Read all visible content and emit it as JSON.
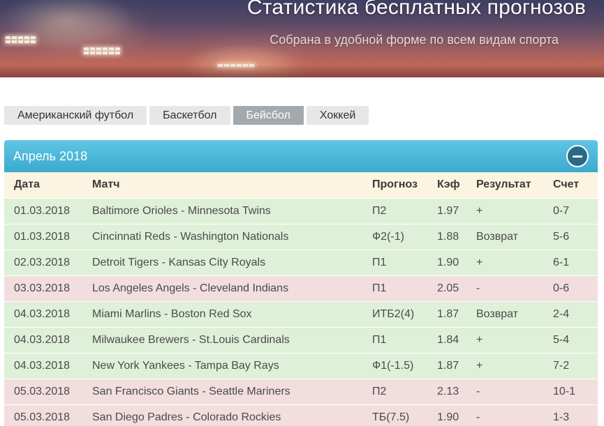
{
  "hero": {
    "title": "Статистика бесплатных прогнозов",
    "subtitle": "Собрана в удобной форме по всем видам спорта"
  },
  "tabs": [
    {
      "label": "Американский футбол",
      "active": false
    },
    {
      "label": "Баскетбол",
      "active": false
    },
    {
      "label": "Бейсбол",
      "active": true
    },
    {
      "label": "Хоккей",
      "active": false
    }
  ],
  "panel": {
    "title": "Апрель 2018",
    "collapse_icon": "minus-circle-icon"
  },
  "table": {
    "headers": {
      "date": "Дата",
      "match": "Матч",
      "prediction": "Прогноз",
      "coef": "Кэф",
      "result": "Результат",
      "score": "Счет"
    },
    "rows": [
      {
        "date": "01.03.2018",
        "match": "Baltimore Orioles - Minnesota Twins",
        "prediction": "П2",
        "coef": "1.97",
        "result": "+",
        "score": "0-7",
        "status": "win"
      },
      {
        "date": "01.03.2018",
        "match": "Cincinnati Reds - Washington Nationals",
        "prediction": "Ф2(-1)",
        "coef": "1.88",
        "result": "Возврат",
        "score": "5-6",
        "status": "refund"
      },
      {
        "date": "02.03.2018",
        "match": "Detroit Tigers - Kansas City Royals",
        "prediction": "П1",
        "coef": "1.90",
        "result": "+",
        "score": "6-1",
        "status": "win"
      },
      {
        "date": "03.03.2018",
        "match": "Los Angeles Angels - Cleveland Indians",
        "prediction": "П1",
        "coef": "2.05",
        "result": "-",
        "score": "0-6",
        "status": "loss"
      },
      {
        "date": "04.03.2018",
        "match": "Miami Marlins - Boston Red Sox",
        "prediction": "ИТБ2(4)",
        "coef": "1.87",
        "result": "Возврат",
        "score": "2-4",
        "status": "refund"
      },
      {
        "date": "04.03.2018",
        "match": "Milwaukee Brewers - St.Louis Cardinals",
        "prediction": "П1",
        "coef": "1.84",
        "result": "+",
        "score": "5-4",
        "status": "win"
      },
      {
        "date": "04.03.2018",
        "match": "New York Yankees - Tampa Bay Rays",
        "prediction": "Ф1(-1.5)",
        "coef": "1.87",
        "result": "+",
        "score": "7-2",
        "status": "win"
      },
      {
        "date": "05.03.2018",
        "match": "San Francisco Giants - Seattle Mariners",
        "prediction": "П2",
        "coef": "2.13",
        "result": "-",
        "score": "10-1",
        "status": "loss"
      },
      {
        "date": "05.03.2018",
        "match": "San Diego Padres - Colorado Rockies",
        "prediction": "ТБ(7.5)",
        "coef": "1.90",
        "result": "-",
        "score": "1-3",
        "status": "loss"
      }
    ]
  },
  "colors": {
    "accent": "#3ba9cf",
    "win_row": "#dff0d8",
    "loss_row": "#f2dede",
    "header_row": "#fbf4e0",
    "active_tab": "#a3a9ad"
  }
}
